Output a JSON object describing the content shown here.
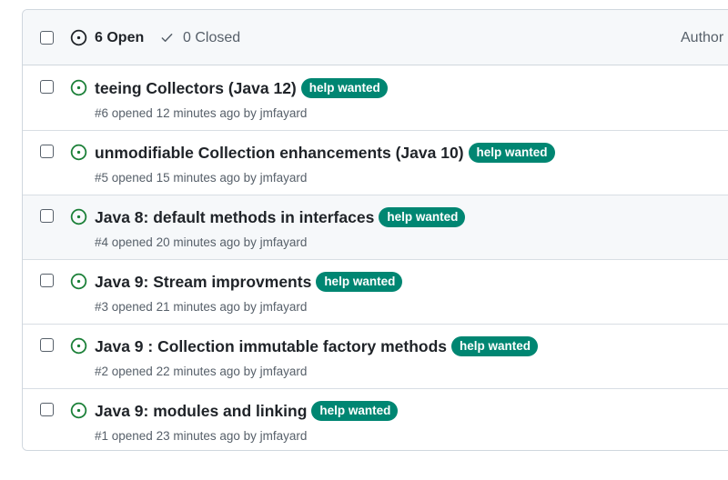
{
  "header": {
    "open_label": "6 Open",
    "closed_label": "0 Closed",
    "author_filter": "Author"
  },
  "colors": {
    "label_bg": "#008672",
    "open_icon": "#1a7f37",
    "hover_row_bg": "#f6f8fa"
  },
  "issues": [
    {
      "title": "teeing Collectors (Java 12)",
      "label": "help wanted",
      "meta": "#6 opened 12 minutes ago by jmfayard",
      "icon": "issue-opened-icon"
    },
    {
      "title": "unmodifiable Collection enhancements (Java 10)",
      "label": "help wanted",
      "meta": "#5 opened 15 minutes ago by jmfayard",
      "icon": "issue-opened-icon"
    },
    {
      "title": "Java 8: default methods in interfaces",
      "label": "help wanted",
      "meta": "#4 opened 20 minutes ago by jmfayard",
      "icon": "issue-opened-icon"
    },
    {
      "title": "Java 9: Stream improvments",
      "label": "help wanted",
      "meta": "#3 opened 21 minutes ago by jmfayard",
      "icon": "issue-opened-icon"
    },
    {
      "title": "Java 9 : Collection immutable factory methods",
      "label": "help wanted",
      "meta": "#2 opened 22 minutes ago by jmfayard",
      "icon": "issue-opened-icon"
    },
    {
      "title": "Java 9: modules and linking",
      "label": "help wanted",
      "meta": "#1 opened 23 minutes ago by jmfayard",
      "icon": "issue-opened-icon"
    }
  ]
}
